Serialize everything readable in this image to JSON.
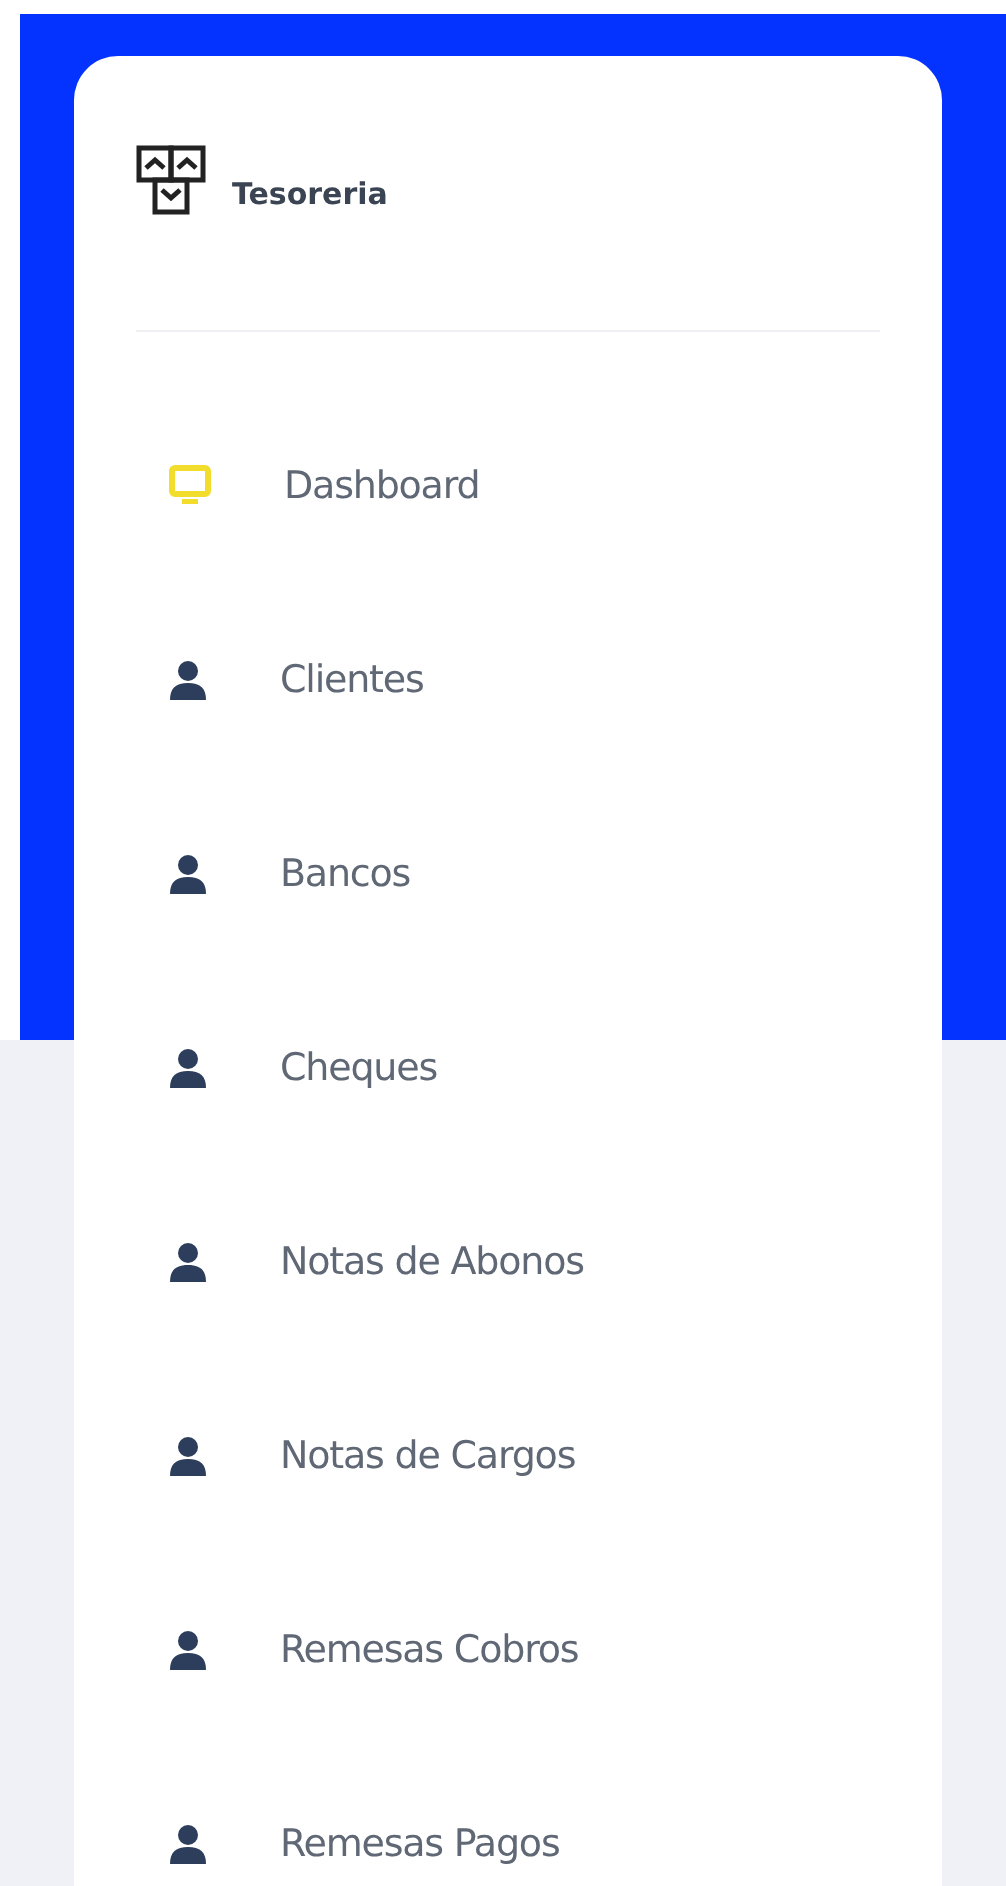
{
  "sidebar": {
    "title": "Tesoreria",
    "items": [
      {
        "label": "Dashboard",
        "kind": "monitor"
      },
      {
        "label": "Clientes",
        "kind": "user"
      },
      {
        "label": "Bancos",
        "kind": "user"
      },
      {
        "label": "Cheques",
        "kind": "user"
      },
      {
        "label": "Notas de Abonos",
        "kind": "user"
      },
      {
        "label": "Notas de Cargos",
        "kind": "user"
      },
      {
        "label": "Remesas Cobros",
        "kind": "user"
      },
      {
        "label": "Remesas Pagos",
        "kind": "user"
      }
    ]
  }
}
